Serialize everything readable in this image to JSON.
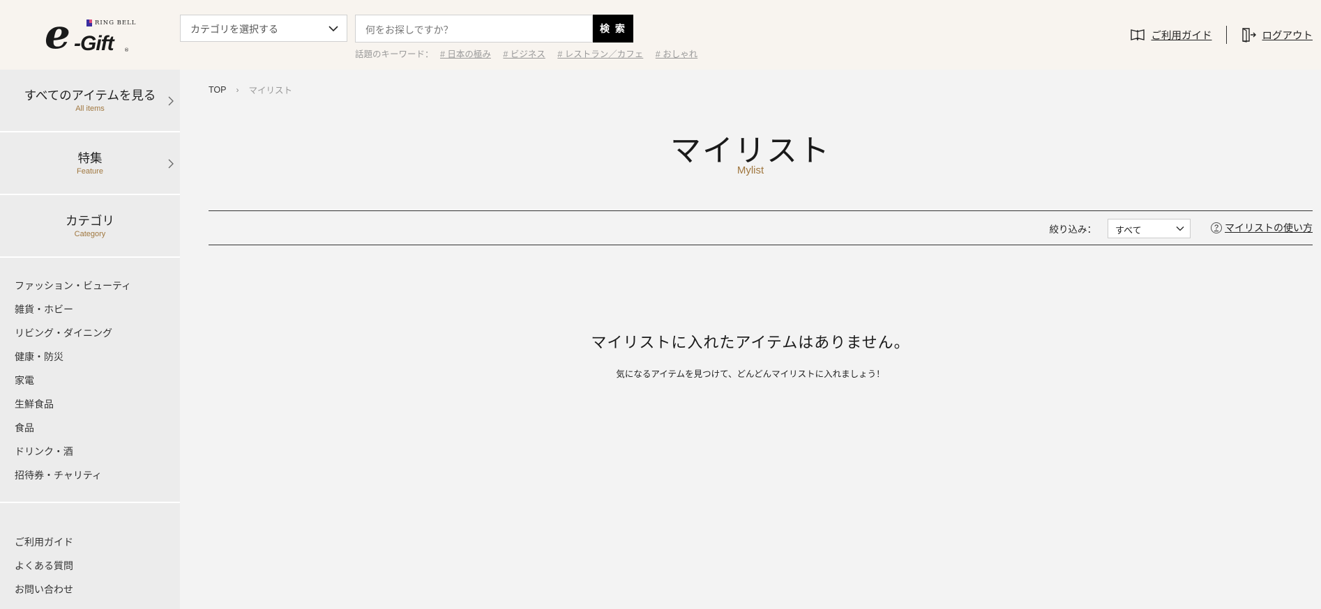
{
  "logo": {
    "brand_small": "RING BELL",
    "brand_big": "e",
    "brand_gift": "-Gift",
    "reg_mark": "®"
  },
  "header": {
    "category_select": "カテゴリを選択する",
    "search_placeholder": "何をお探しですか？",
    "search_button": "検 索",
    "keywords_label": "話題のキーワード：",
    "keywords": [
      "# 日本の極み",
      "# ビジネス",
      "# レストラン／カフェ",
      "# おしゃれ"
    ],
    "guide_link": "ご利用ガイド",
    "logout_link": "ログアウト"
  },
  "sidebar": {
    "blocks": [
      {
        "jp": "すべてのアイテムを見る",
        "en": "All items",
        "arrow": true
      },
      {
        "jp": "特集",
        "en": "Feature",
        "arrow": true
      },
      {
        "jp": "カテゴリ",
        "en": "Category",
        "arrow": false
      }
    ],
    "categories": [
      "ファッション・ビューティ",
      "雑貨・ホビー",
      "リビング・ダイニング",
      "健康・防災",
      "家電",
      "生鮮食品",
      "食品",
      "ドリンク・酒",
      "招待券・チャリティ"
    ],
    "footer_links": [
      "ご利用ガイド",
      "よくある質問",
      "お問い合わせ"
    ]
  },
  "breadcrumb": {
    "top": "TOP",
    "current": "マイリスト"
  },
  "page": {
    "title": "マイリスト",
    "subtitle": "Mylist",
    "filter_label": "絞り込み：",
    "filter_value": "すべて",
    "help_link": "マイリストの使い方",
    "empty_title": "マイリストに入れたアイテムはありません。",
    "empty_sub": "気になるアイテムを見つけて、どんどんマイリストに入れましょう！"
  },
  "colors": {
    "accent": "#a0773f",
    "header_bg": "#f8f4ef",
    "sidebar_bg": "#ececec",
    "page_bg": "#f3f3f3"
  }
}
